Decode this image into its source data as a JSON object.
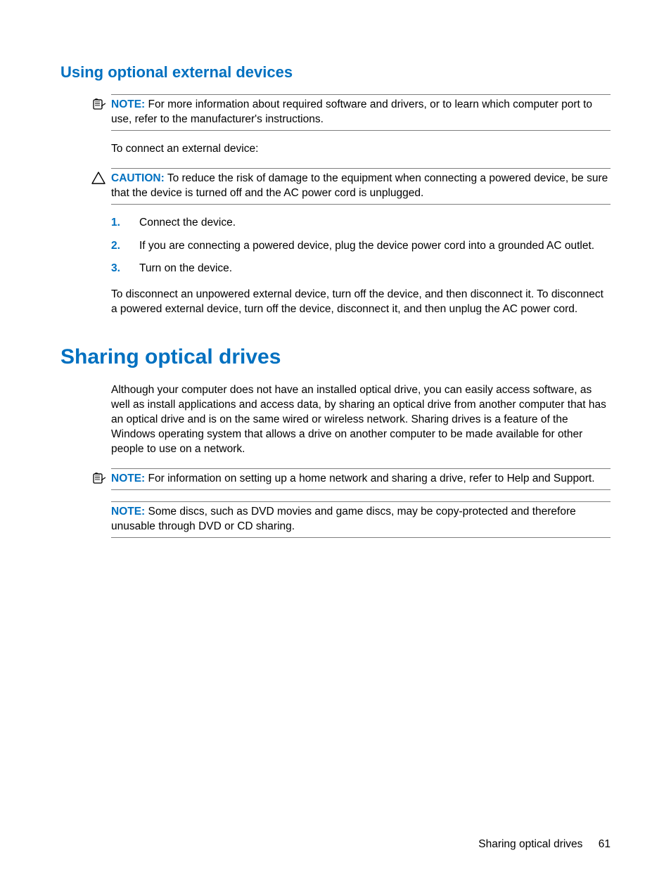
{
  "section1": {
    "heading": "Using optional external devices",
    "note1": {
      "label": "NOTE:",
      "text": "For more information about required software and drivers, or to learn which computer port to use, refer to the manufacturer's instructions."
    },
    "intro": "To connect an external device:",
    "caution": {
      "label": "CAUTION:",
      "text": "To reduce the risk of damage to the equipment when connecting a powered device, be sure that the device is turned off and the AC power cord is unplugged."
    },
    "steps": [
      "Connect the device.",
      "If you are connecting a powered device, plug the device power cord into a grounded AC outlet.",
      "Turn on the device."
    ],
    "disconnect": "To disconnect an unpowered external device, turn off the device, and then disconnect it. To disconnect a powered external device, turn off the device, disconnect it, and then unplug the AC power cord."
  },
  "section2": {
    "heading": "Sharing optical drives",
    "body": "Although your computer does not have an installed optical drive, you can easily access software, as well as install applications and access data, by sharing an optical drive from another computer that has an optical drive and is on the same wired or wireless network. Sharing drives is a feature of the Windows operating system that allows a drive on another computer to be made available for other people to use on a network.",
    "note1": {
      "label": "NOTE:",
      "text": "For information on setting up a home network and sharing a drive, refer to Help and Support."
    },
    "note2": {
      "label": "NOTE:",
      "text": "Some discs, such as DVD movies and game discs, may be copy-protected and therefore unusable through DVD or CD sharing."
    }
  },
  "footer": {
    "title": "Sharing optical drives",
    "page": "61"
  }
}
